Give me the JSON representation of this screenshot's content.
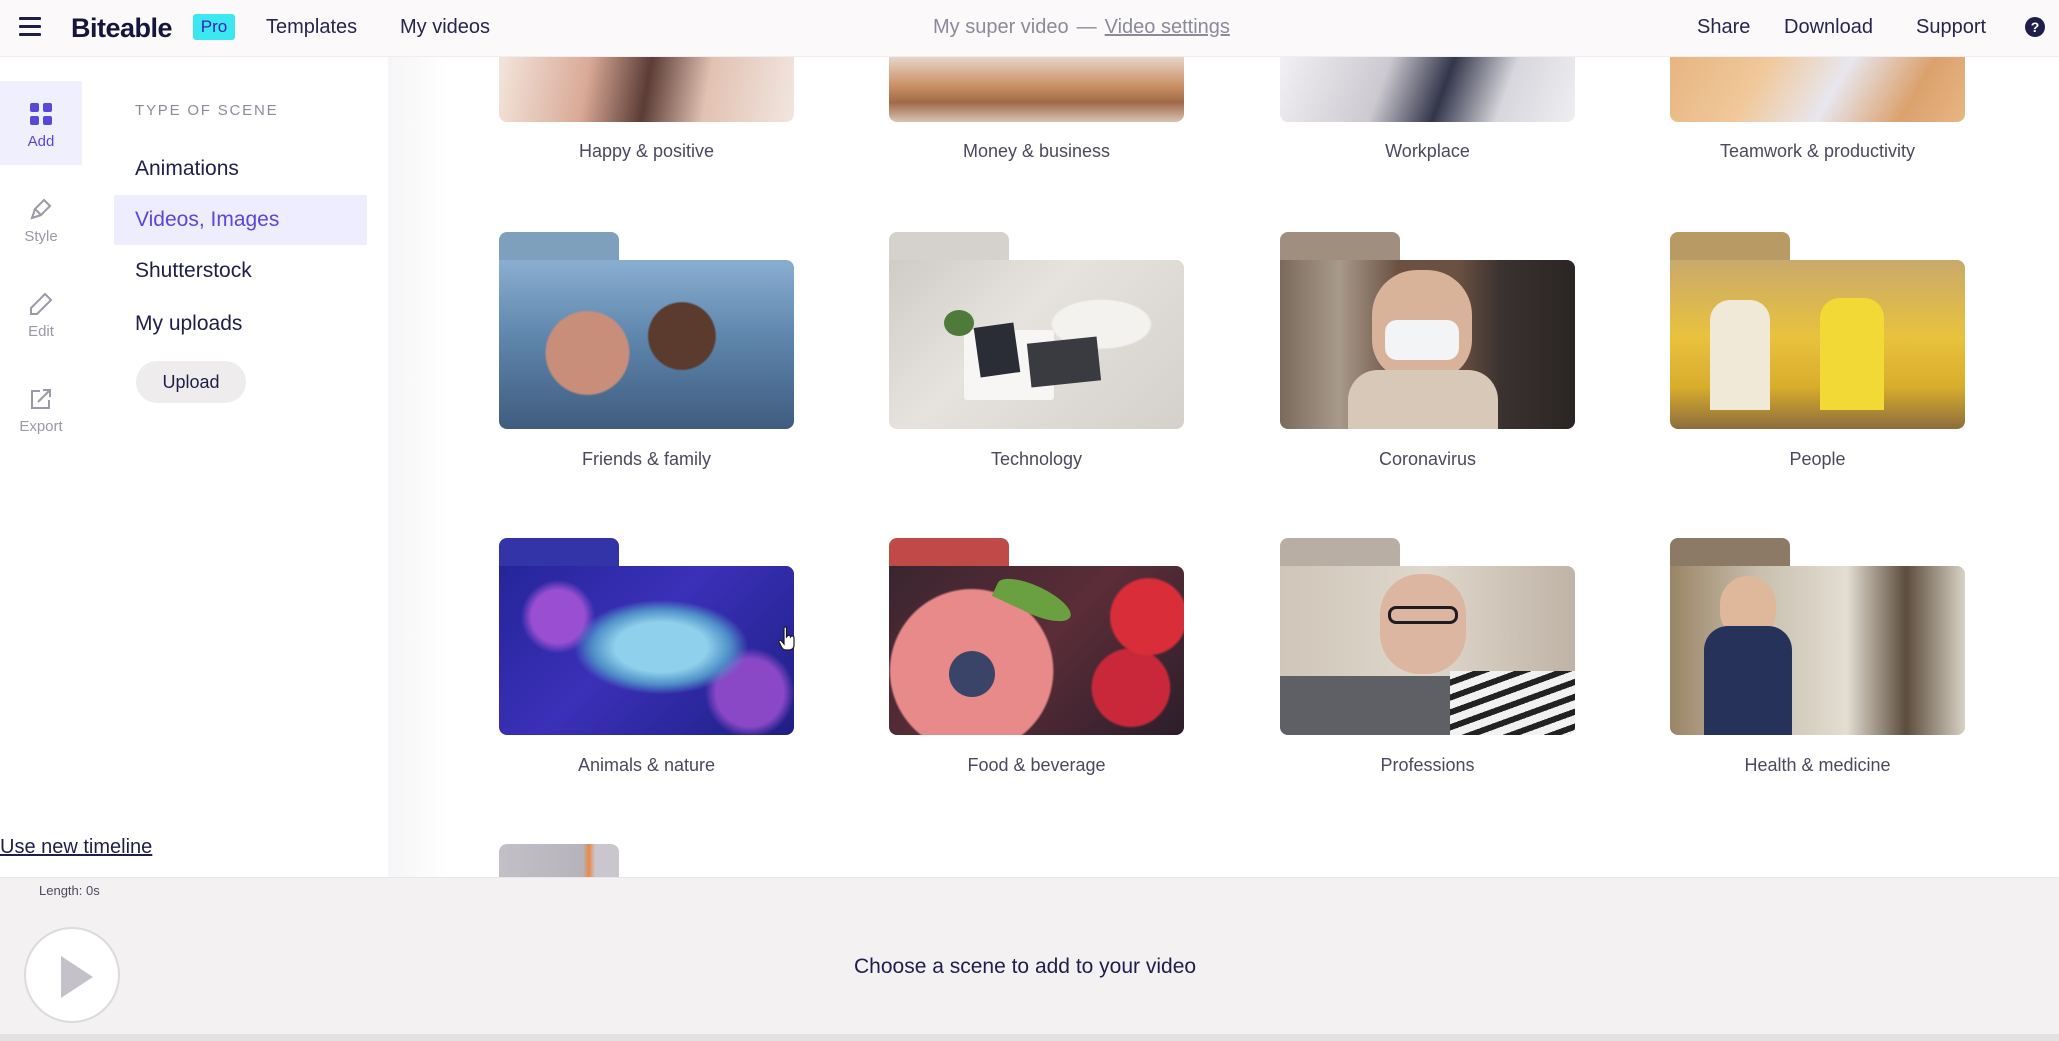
{
  "topbar": {
    "menu_icon": "hamburger-menu-icon",
    "logo": "Biteable",
    "badge": "Pro",
    "nav": [
      "Templates",
      "My videos"
    ],
    "video_title": "My super video",
    "separator": "—",
    "video_settings": "Video settings",
    "actions": [
      "Share",
      "Download",
      "Support"
    ],
    "help_icon": "?"
  },
  "rail": {
    "items": [
      {
        "label": "Add",
        "icon": "grid-icon",
        "active": true
      },
      {
        "label": "Style",
        "icon": "brush-icon",
        "active": false
      },
      {
        "label": "Edit",
        "icon": "pencil-icon",
        "active": false
      },
      {
        "label": "Export",
        "icon": "export-icon",
        "active": false
      }
    ]
  },
  "panel": {
    "heading": "TYPE OF SCENE",
    "items": [
      "Animations",
      "Videos, Images",
      "Shutterstock",
      "My uploads"
    ],
    "active_item": "Videos, Images",
    "upload_label": "Upload",
    "new_timeline_link": "Use new timeline"
  },
  "categories": {
    "row0": [
      "Happy & positive",
      "Money & business",
      "Workplace",
      "Teamwork & productivity"
    ],
    "row1": [
      "Friends & family",
      "Technology",
      "Coronavirus",
      "People"
    ],
    "row2": [
      "Animals & nature",
      "Food & beverage",
      "Professions",
      "Health & medicine"
    ]
  },
  "timeline": {
    "length": "Length: 0s",
    "prompt": "Choose a scene to add to your video"
  },
  "colors": {
    "accent": "#5b47d6",
    "pro_badge": "#3ce8f0",
    "text": "#1f1e4a"
  }
}
